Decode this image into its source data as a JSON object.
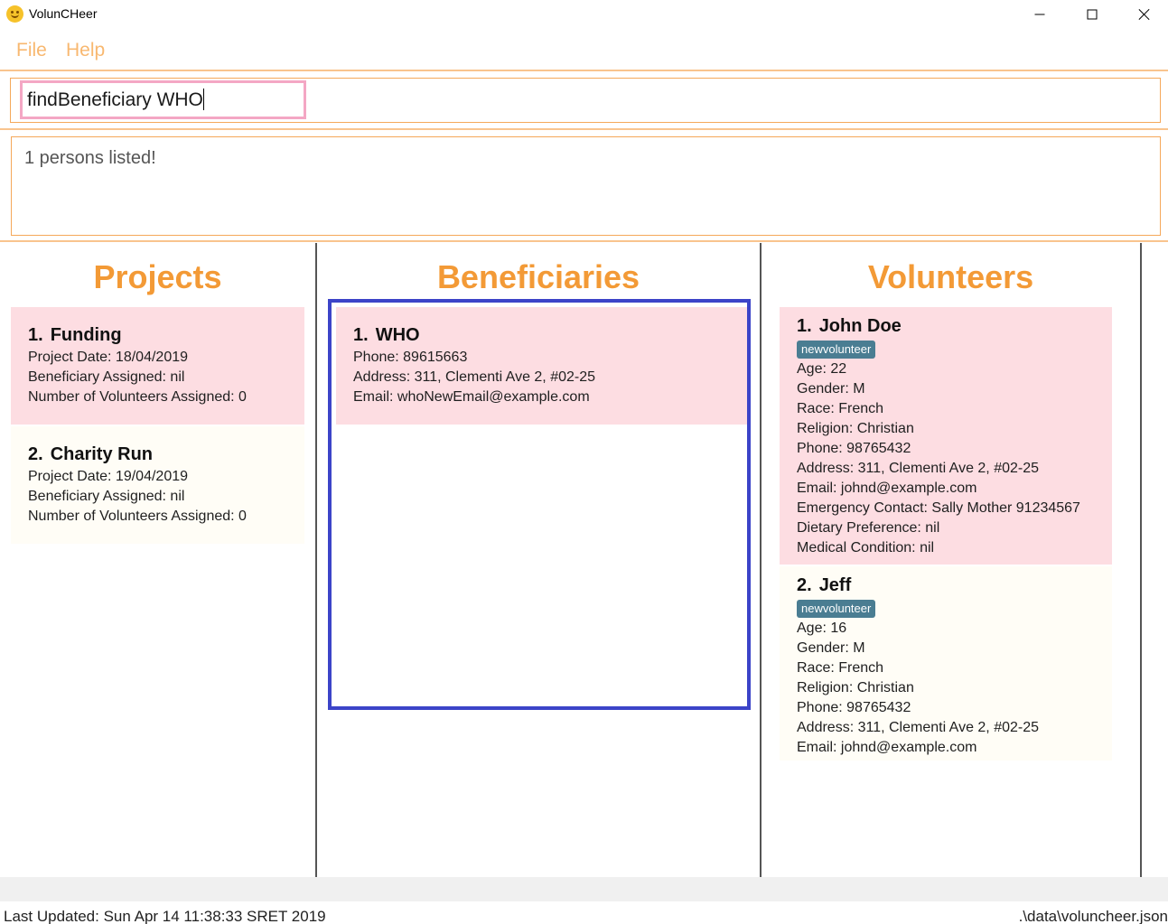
{
  "window": {
    "title": "VolunCHeer"
  },
  "menu": {
    "file": "File",
    "help": "Help"
  },
  "command": {
    "value": "findBeneficiary WHO"
  },
  "result": {
    "message": "1 persons listed!"
  },
  "projects": {
    "title": "Projects",
    "items": [
      {
        "index": "1.",
        "name": "Funding",
        "date": "Project Date: 18/04/2019",
        "beneficiary": "Beneficiary Assigned: nil",
        "volunteers": "Number of Volunteers Assigned: 0"
      },
      {
        "index": "2.",
        "name": "Charity Run",
        "date": "Project Date: 19/04/2019",
        "beneficiary": "Beneficiary Assigned: nil",
        "volunteers": "Number of Volunteers Assigned: 0"
      }
    ]
  },
  "beneficiaries": {
    "title": "Beneficiaries",
    "items": [
      {
        "index": "1.",
        "name": "WHO",
        "phone": "Phone: 89615663",
        "address": "Address: 311, Clementi Ave 2, #02-25",
        "email": "Email: whoNewEmail@example.com"
      }
    ]
  },
  "volunteers": {
    "title": "Volunteers",
    "items": [
      {
        "index": "1.",
        "name": "John Doe",
        "tag": "newvolunteer",
        "age": "Age: 22",
        "gender": "Gender: M",
        "race": "Race: French",
        "religion": "Religion: Christian",
        "phone": "Phone: 98765432",
        "address": "Address: 311, Clementi Ave 2, #02-25",
        "email": "Email: johnd@example.com",
        "emergency": "Emergency Contact: Sally Mother 91234567",
        "dietary": "Dietary Preference: nil",
        "medical": "Medical Condition: nil"
      },
      {
        "index": "2.",
        "name": "Jeff",
        "tag": "newvolunteer",
        "age": "Age: 16",
        "gender": "Gender: M",
        "race": "Race: French",
        "religion": "Religion: Christian",
        "phone": "Phone: 98765432",
        "address": "Address: 311, Clementi Ave 2, #02-25",
        "email": "Email: johnd@example.com"
      }
    ]
  },
  "status": {
    "last_updated": "Last Updated: Sun Apr 14 11:38:33 SRET 2019",
    "file_path": ".\\data\\voluncheer.json"
  },
  "colors": {
    "accent": "#f39a36",
    "selected_card": "#fddde2",
    "card": "#fffdf6",
    "tag": "#4a7d92",
    "selection_frame": "#3c44c8",
    "command_border": "#f4a7c4"
  },
  "icons": {
    "app": "smiley-app-icon",
    "minimize": "minimize-icon",
    "maximize": "maximize-icon",
    "close": "close-icon"
  }
}
